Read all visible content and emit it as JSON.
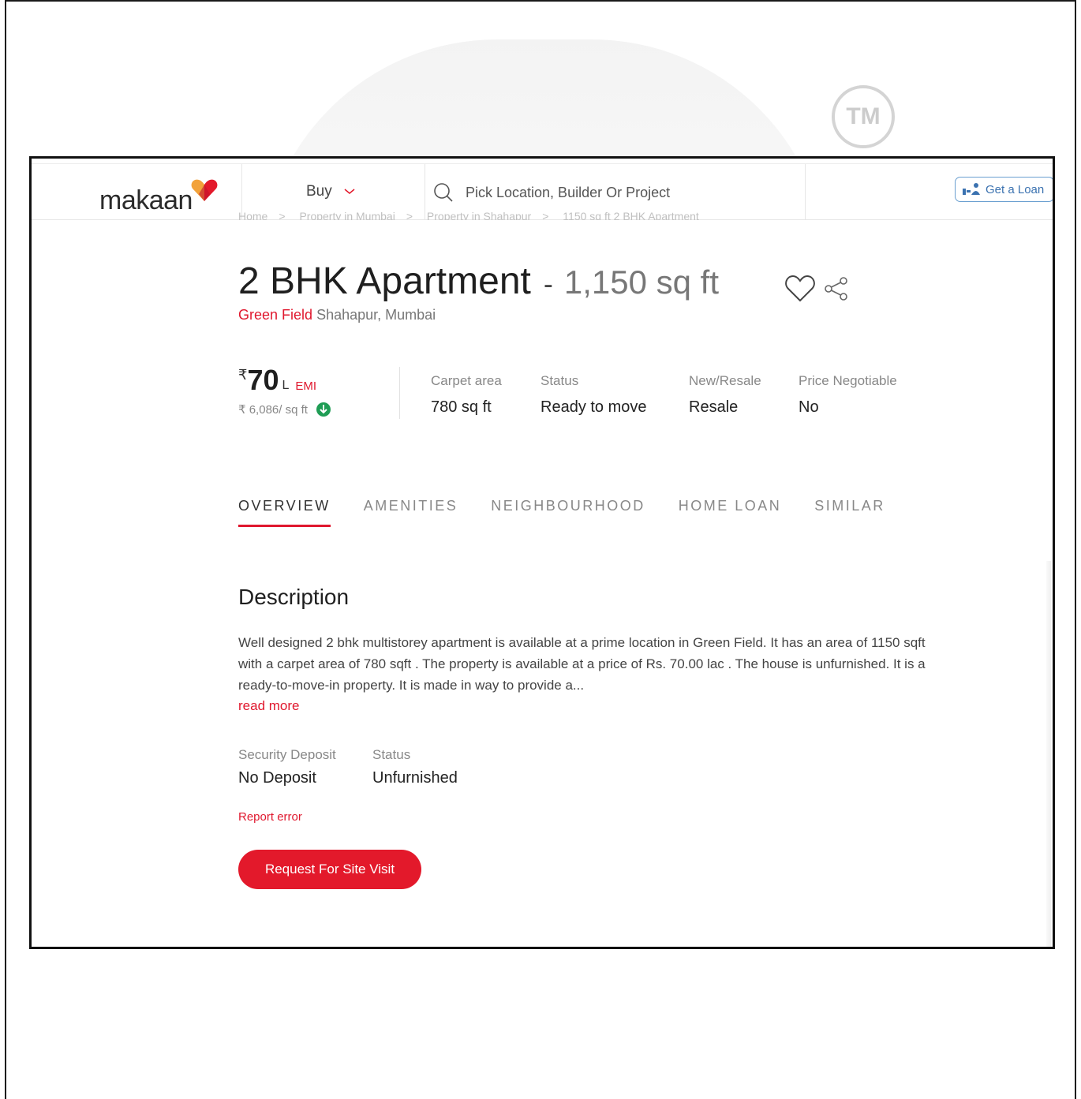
{
  "watermark": {
    "mark": "TM"
  },
  "header": {
    "logo_text": "makaan",
    "buy_label": "Buy",
    "search_placeholder": "Pick Location, Builder Or Project",
    "loan_label": "Get a Loan"
  },
  "breadcrumb": [
    "Home",
    "Property in Mumbai",
    "Property in Shahapur",
    "1150 sq ft 2 BHK Apartment"
  ],
  "listing": {
    "title": "2 BHK Apartment",
    "dash": "-",
    "area": "1,150 sq ft",
    "project": "Green Field",
    "locality": "Shahapur,",
    "city": "Mumbai",
    "currency": "₹",
    "price": "70",
    "price_unit": "L",
    "emi_label": "EMI",
    "rate": "₹ 6,086/ sq ft",
    "attributes": [
      {
        "label": "Carpet area",
        "value": "780 sq ft"
      },
      {
        "label": "Status",
        "value": "Ready to move"
      },
      {
        "label": "New/Resale",
        "value": "Resale"
      },
      {
        "label": "Price Negotiable",
        "value": "No"
      }
    ]
  },
  "tabs": [
    "OVERVIEW",
    "AMENITIES",
    "NEIGHBOURHOOD",
    "HOME LOAN",
    "SIMILAR"
  ],
  "description": {
    "title": "Description",
    "text": "Well designed 2 bhk multistorey apartment is available at a prime location in Green Field. It has an area of 1150 sqft with a carpet area of 780 sqft . The property is available at a price of Rs. 70.00 lac . The house is unfurnished. It is a ready-to-move-in property. It is made in way to provide a...",
    "read_more": "read more",
    "details": [
      {
        "label": "Security Deposit",
        "value": "No Deposit"
      },
      {
        "label": "Status",
        "value": "Unfurnished"
      }
    ],
    "report_error": "Report error",
    "cta": "Request For Site Visit"
  },
  "colors": {
    "accent": "#e3192b",
    "loan_blue": "#3b72b0",
    "positive_green": "#1f9d55"
  }
}
